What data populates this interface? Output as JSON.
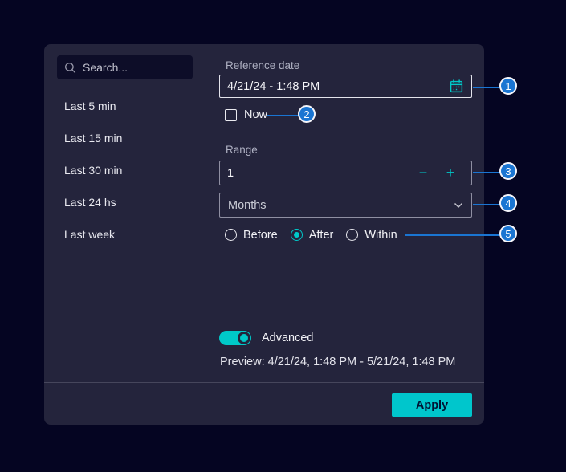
{
  "colors": {
    "page_bg": "#050522",
    "panel_bg": "#24243c",
    "accent_teal": "#00c9c9",
    "apply_button_bg": "#00c6cc",
    "badge_blue": "#1a75d2"
  },
  "sidebar": {
    "search": {
      "placeholder": "Search...",
      "icon": "search-icon"
    },
    "items": [
      {
        "label": "Last 5 min"
      },
      {
        "label": "Last 15 min"
      },
      {
        "label": "Last 30 min"
      },
      {
        "label": "Last 24 hs"
      },
      {
        "label": "Last week"
      }
    ]
  },
  "main": {
    "reference_date": {
      "label": "Reference date",
      "value": "4/21/24 - 1:48 PM",
      "icon": "calendar-icon"
    },
    "now": {
      "label": "Now",
      "checked": false
    },
    "range": {
      "label": "Range",
      "value": "1",
      "decrement_icon": "minus-icon",
      "increment_icon": "plus-icon"
    },
    "unit": {
      "value": "Months",
      "icon": "chevron-down-icon"
    },
    "direction": {
      "options": [
        {
          "label": "Before",
          "selected": false
        },
        {
          "label": "After",
          "selected": true
        },
        {
          "label": "Within",
          "selected": false
        }
      ]
    },
    "advanced": {
      "label": "Advanced",
      "on": true
    },
    "preview": "Preview: 4/21/24, 1:48 PM - 5/21/24, 1:48 PM"
  },
  "footer": {
    "apply": "Apply"
  },
  "annotations": [
    {
      "number": "1"
    },
    {
      "number": "2"
    },
    {
      "number": "3"
    },
    {
      "number": "4"
    },
    {
      "number": "5"
    }
  ]
}
